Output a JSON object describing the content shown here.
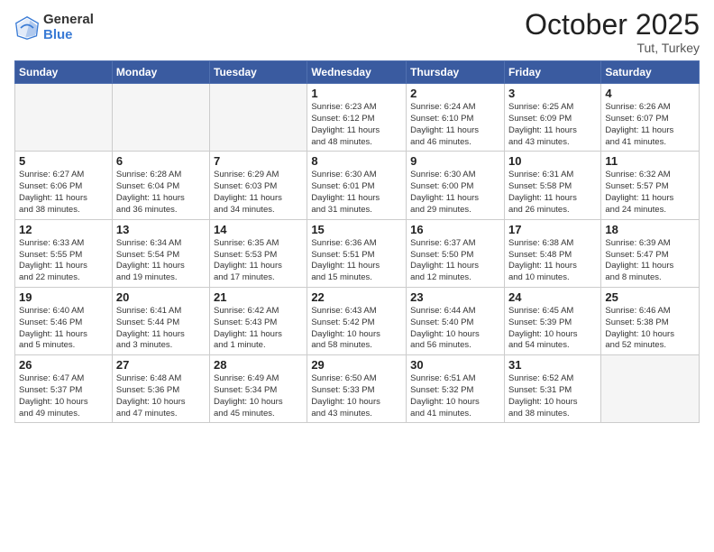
{
  "logo": {
    "general": "General",
    "blue": "Blue"
  },
  "header": {
    "month": "October 2025",
    "location": "Tut, Turkey"
  },
  "days_of_week": [
    "Sunday",
    "Monday",
    "Tuesday",
    "Wednesday",
    "Thursday",
    "Friday",
    "Saturday"
  ],
  "weeks": [
    [
      {
        "day": "",
        "info": ""
      },
      {
        "day": "",
        "info": ""
      },
      {
        "day": "",
        "info": ""
      },
      {
        "day": "1",
        "info": "Sunrise: 6:23 AM\nSunset: 6:12 PM\nDaylight: 11 hours\nand 48 minutes."
      },
      {
        "day": "2",
        "info": "Sunrise: 6:24 AM\nSunset: 6:10 PM\nDaylight: 11 hours\nand 46 minutes."
      },
      {
        "day": "3",
        "info": "Sunrise: 6:25 AM\nSunset: 6:09 PM\nDaylight: 11 hours\nand 43 minutes."
      },
      {
        "day": "4",
        "info": "Sunrise: 6:26 AM\nSunset: 6:07 PM\nDaylight: 11 hours\nand 41 minutes."
      }
    ],
    [
      {
        "day": "5",
        "info": "Sunrise: 6:27 AM\nSunset: 6:06 PM\nDaylight: 11 hours\nand 38 minutes."
      },
      {
        "day": "6",
        "info": "Sunrise: 6:28 AM\nSunset: 6:04 PM\nDaylight: 11 hours\nand 36 minutes."
      },
      {
        "day": "7",
        "info": "Sunrise: 6:29 AM\nSunset: 6:03 PM\nDaylight: 11 hours\nand 34 minutes."
      },
      {
        "day": "8",
        "info": "Sunrise: 6:30 AM\nSunset: 6:01 PM\nDaylight: 11 hours\nand 31 minutes."
      },
      {
        "day": "9",
        "info": "Sunrise: 6:30 AM\nSunset: 6:00 PM\nDaylight: 11 hours\nand 29 minutes."
      },
      {
        "day": "10",
        "info": "Sunrise: 6:31 AM\nSunset: 5:58 PM\nDaylight: 11 hours\nand 26 minutes."
      },
      {
        "day": "11",
        "info": "Sunrise: 6:32 AM\nSunset: 5:57 PM\nDaylight: 11 hours\nand 24 minutes."
      }
    ],
    [
      {
        "day": "12",
        "info": "Sunrise: 6:33 AM\nSunset: 5:55 PM\nDaylight: 11 hours\nand 22 minutes."
      },
      {
        "day": "13",
        "info": "Sunrise: 6:34 AM\nSunset: 5:54 PM\nDaylight: 11 hours\nand 19 minutes."
      },
      {
        "day": "14",
        "info": "Sunrise: 6:35 AM\nSunset: 5:53 PM\nDaylight: 11 hours\nand 17 minutes."
      },
      {
        "day": "15",
        "info": "Sunrise: 6:36 AM\nSunset: 5:51 PM\nDaylight: 11 hours\nand 15 minutes."
      },
      {
        "day": "16",
        "info": "Sunrise: 6:37 AM\nSunset: 5:50 PM\nDaylight: 11 hours\nand 12 minutes."
      },
      {
        "day": "17",
        "info": "Sunrise: 6:38 AM\nSunset: 5:48 PM\nDaylight: 11 hours\nand 10 minutes."
      },
      {
        "day": "18",
        "info": "Sunrise: 6:39 AM\nSunset: 5:47 PM\nDaylight: 11 hours\nand 8 minutes."
      }
    ],
    [
      {
        "day": "19",
        "info": "Sunrise: 6:40 AM\nSunset: 5:46 PM\nDaylight: 11 hours\nand 5 minutes."
      },
      {
        "day": "20",
        "info": "Sunrise: 6:41 AM\nSunset: 5:44 PM\nDaylight: 11 hours\nand 3 minutes."
      },
      {
        "day": "21",
        "info": "Sunrise: 6:42 AM\nSunset: 5:43 PM\nDaylight: 11 hours\nand 1 minute."
      },
      {
        "day": "22",
        "info": "Sunrise: 6:43 AM\nSunset: 5:42 PM\nDaylight: 10 hours\nand 58 minutes."
      },
      {
        "day": "23",
        "info": "Sunrise: 6:44 AM\nSunset: 5:40 PM\nDaylight: 10 hours\nand 56 minutes."
      },
      {
        "day": "24",
        "info": "Sunrise: 6:45 AM\nSunset: 5:39 PM\nDaylight: 10 hours\nand 54 minutes."
      },
      {
        "day": "25",
        "info": "Sunrise: 6:46 AM\nSunset: 5:38 PM\nDaylight: 10 hours\nand 52 minutes."
      }
    ],
    [
      {
        "day": "26",
        "info": "Sunrise: 6:47 AM\nSunset: 5:37 PM\nDaylight: 10 hours\nand 49 minutes."
      },
      {
        "day": "27",
        "info": "Sunrise: 6:48 AM\nSunset: 5:36 PM\nDaylight: 10 hours\nand 47 minutes."
      },
      {
        "day": "28",
        "info": "Sunrise: 6:49 AM\nSunset: 5:34 PM\nDaylight: 10 hours\nand 45 minutes."
      },
      {
        "day": "29",
        "info": "Sunrise: 6:50 AM\nSunset: 5:33 PM\nDaylight: 10 hours\nand 43 minutes."
      },
      {
        "day": "30",
        "info": "Sunrise: 6:51 AM\nSunset: 5:32 PM\nDaylight: 10 hours\nand 41 minutes."
      },
      {
        "day": "31",
        "info": "Sunrise: 6:52 AM\nSunset: 5:31 PM\nDaylight: 10 hours\nand 38 minutes."
      },
      {
        "day": "",
        "info": ""
      }
    ]
  ]
}
